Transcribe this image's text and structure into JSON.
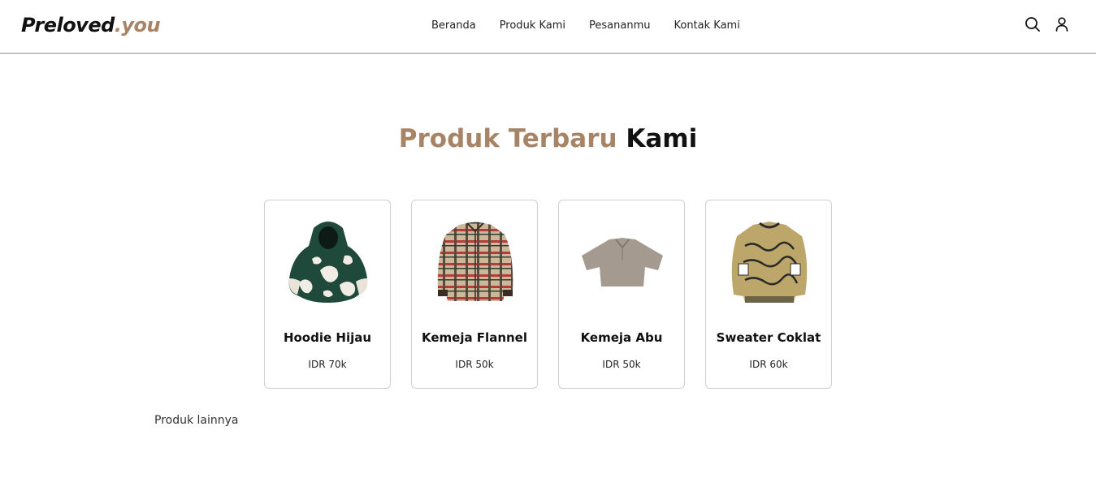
{
  "brand": {
    "name": "Preloved",
    "suffix": ".you",
    "accent_color": "#a88466"
  },
  "nav": {
    "items": [
      {
        "label": "Beranda"
      },
      {
        "label": "Produk Kami"
      },
      {
        "label": "Pesananmu"
      },
      {
        "label": "Kontak Kami"
      }
    ],
    "icons": [
      "search-icon",
      "user-icon"
    ]
  },
  "section": {
    "title_accent": "Produk Terbaru",
    "title_dark": "Kami"
  },
  "products": [
    {
      "name": "Hoodie Hijau",
      "price": "IDR 70k",
      "image": "green-hoodie"
    },
    {
      "name": "Kemeja Flannel",
      "price": "IDR 50k",
      "image": "flannel-shirt"
    },
    {
      "name": "Kemeja Abu",
      "price": "IDR 50k",
      "image": "grey-shirt"
    },
    {
      "name": "Sweater Coklat",
      "price": "IDR 60k",
      "image": "brown-sweater"
    }
  ],
  "more_link": "Produk lainnya"
}
